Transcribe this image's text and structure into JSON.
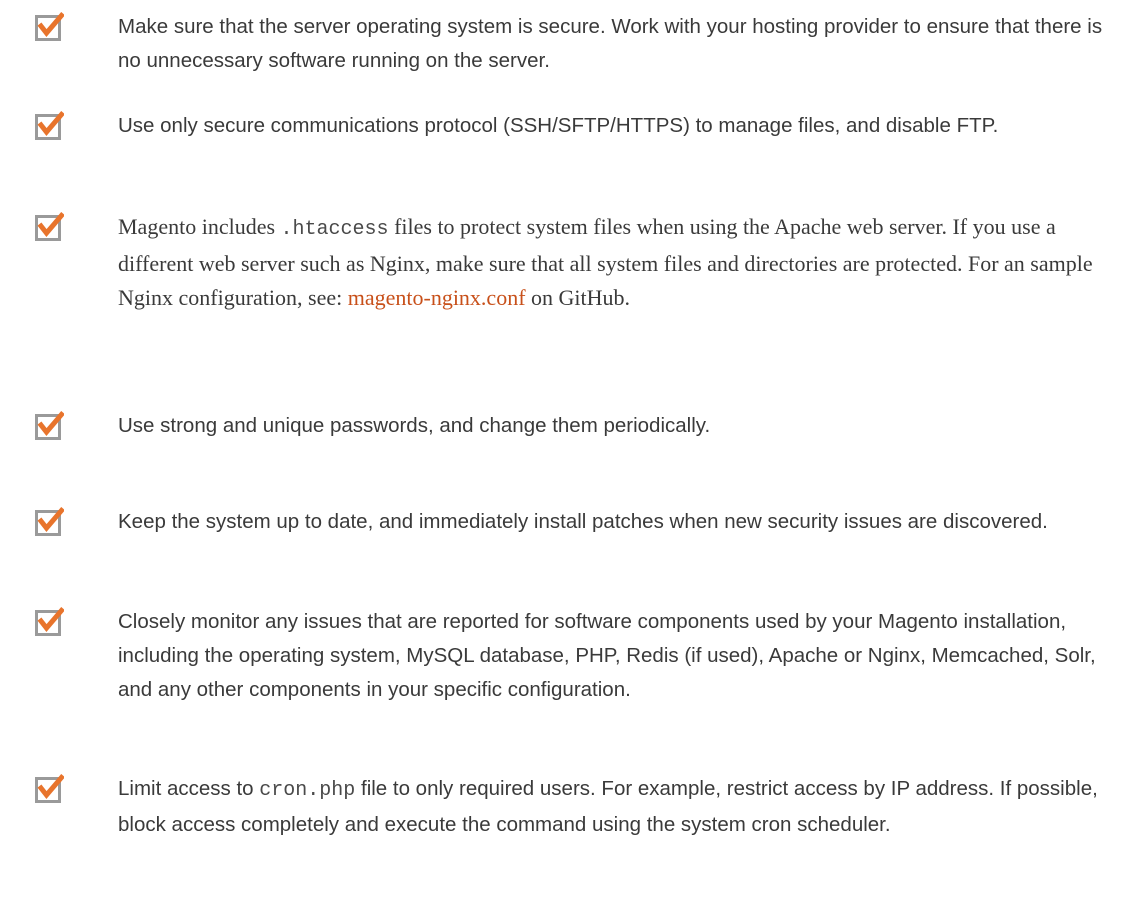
{
  "theme": {
    "checkbox_accent": "#e8742c",
    "checkbox_border": "#9a9a9a",
    "link_color": "#c8501a",
    "text_color": "#3a3a3a"
  },
  "items": [
    {
      "icon": "checked-box-icon",
      "text": "Make sure that the server operating system is secure. Work with your hosting provider to ensure that there is no unnecessary software running on the server."
    },
    {
      "icon": "checked-box-icon",
      "text": "Use only secure communications protocol (SSH/SFTP/HTTPS) to manage files, and disable FTP."
    },
    {
      "icon": "checked-box-icon",
      "text_before": "Magento includes ",
      "code": ".htaccess",
      "text_after": " files to protect system files when using the Apache web server. If you use a different web server such as Nginx, make sure that all system files and directories are protected. For an sample Nginx configuration, see: ",
      "link": "magento-nginx.conf",
      "text_end": " on GitHub."
    },
    {
      "icon": "checked-box-icon",
      "text": "Use strong and unique passwords, and change them periodically."
    },
    {
      "icon": "checked-box-icon",
      "text": "Keep the system up to date, and immediately install patches when new security issues are discovered."
    },
    {
      "icon": "checked-box-icon",
      "text": "Closely monitor any issues that are reported for software components used by your Magento installation, including the operating system, MySQL database, PHP, Redis (if used), Apache or Nginx, Memcached, Solr, and any other components in your specific configuration."
    },
    {
      "icon": "checked-box-icon",
      "text_before": "Limit access to ",
      "code": "cron.php",
      "text_after": " file to only required users. For example, restrict access by IP address. If possible, block access completely and execute the command using the system cron scheduler."
    }
  ]
}
